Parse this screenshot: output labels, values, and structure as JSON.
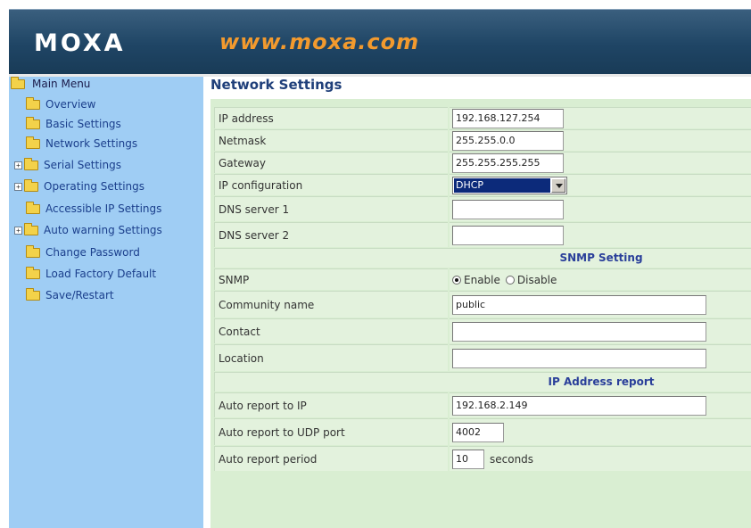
{
  "header": {
    "logo": "MOXA",
    "url": "www.moxa.com"
  },
  "sidebar": {
    "root_label": "Main Menu",
    "items": [
      {
        "label": "Overview",
        "expandable": false
      },
      {
        "label": "Basic Settings",
        "expandable": false
      },
      {
        "label": "Network Settings",
        "expandable": false
      },
      {
        "label": "Serial Settings",
        "expandable": true
      },
      {
        "label": "Operating Settings",
        "expandable": true
      },
      {
        "label": "Accessible IP Settings",
        "expandable": false
      },
      {
        "label": "Auto warning Settings",
        "expandable": true
      },
      {
        "label": "Change Password",
        "expandable": false
      },
      {
        "label": "Load Factory Default",
        "expandable": false
      },
      {
        "label": "Save/Restart",
        "expandable": false
      }
    ]
  },
  "page_title": "Network Settings",
  "network": {
    "ip_address": {
      "label": "IP address",
      "value": "192.168.127.254"
    },
    "netmask": {
      "label": "Netmask",
      "value": "255.255.0.0"
    },
    "gateway": {
      "label": "Gateway",
      "value": "255.255.255.255"
    },
    "ip_configuration": {
      "label": "IP configuration",
      "value": "DHCP"
    },
    "dns_server_1": {
      "label": "DNS server 1",
      "value": ""
    },
    "dns_server_2": {
      "label": "DNS server 2",
      "value": ""
    }
  },
  "snmp_section": {
    "title": "SNMP Setting",
    "snmp": {
      "label": "SNMP",
      "options": [
        "Enable",
        "Disable"
      ],
      "selected": "Enable"
    },
    "community_name": {
      "label": "Community name",
      "value": "public"
    },
    "contact": {
      "label": "Contact",
      "value": ""
    },
    "location": {
      "label": "Location",
      "value": ""
    }
  },
  "ip_report_section": {
    "title": "IP Address report",
    "auto_report_ip": {
      "label": "Auto report to IP",
      "value": "192.168.2.149"
    },
    "auto_report_udp_port": {
      "label": "Auto report to UDP port",
      "value": "4002"
    },
    "auto_report_period": {
      "label": "Auto report period",
      "value": "10",
      "unit": "seconds"
    }
  },
  "colors": {
    "header_bg": "#1f4565",
    "url_orange": "#f29a2e",
    "sidebar_bg": "#9fcdf4",
    "panel_bg": "#d9eed2",
    "section_title": "#2a3f9a"
  }
}
